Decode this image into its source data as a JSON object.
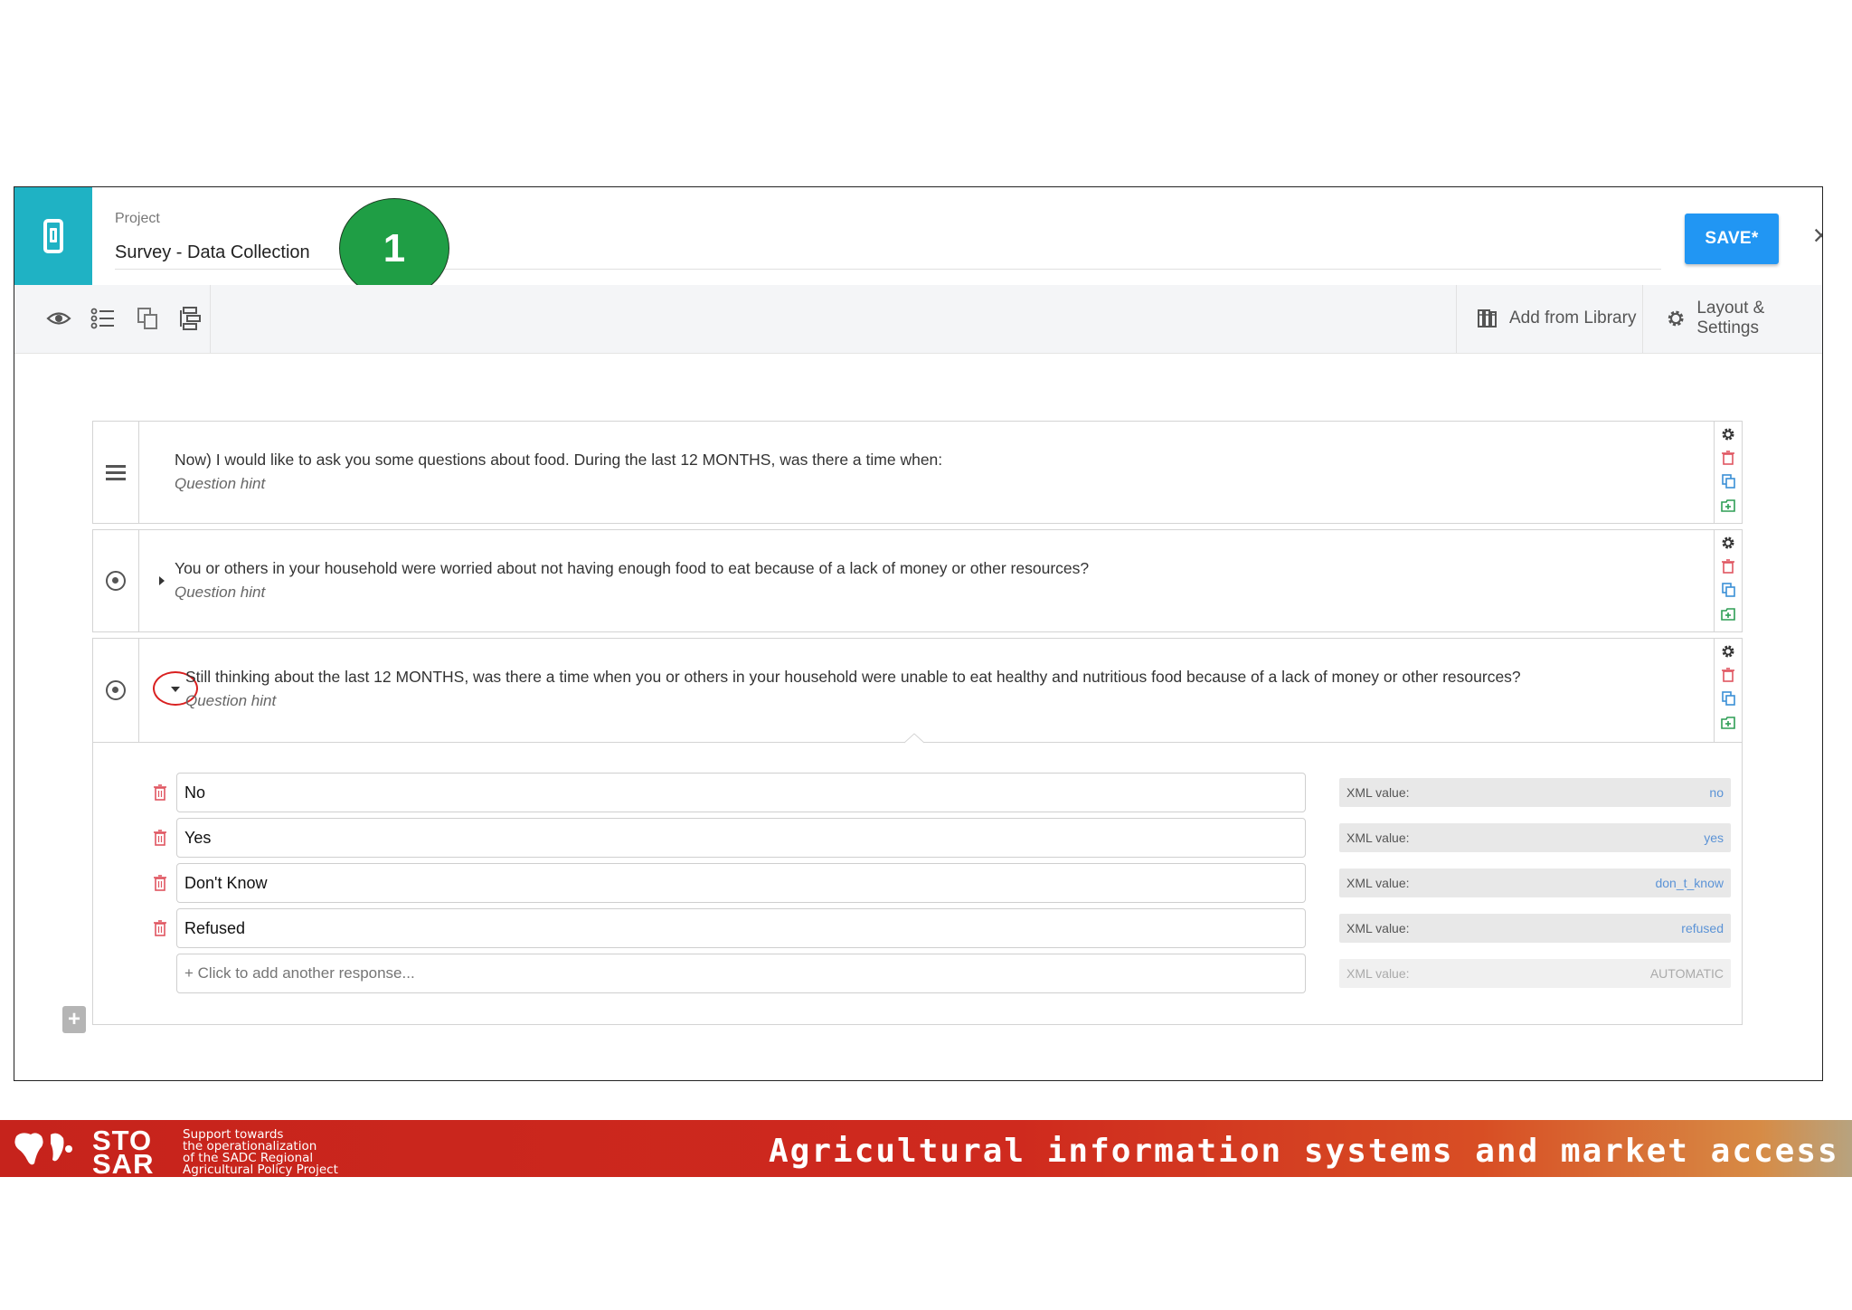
{
  "header": {
    "project_label": "Project",
    "project_title": "Survey - Data Collection",
    "step_badge": "1",
    "save_label": "SAVE*",
    "close_symbol": "×",
    "accent_color": "#1fb2c4",
    "save_color": "#2196f3"
  },
  "toolbar": {
    "icons": [
      "eye-icon",
      "question-list-icon",
      "copy-icon",
      "form-structure-icon"
    ],
    "add_from_library": "Add from Library",
    "layout_settings": "Layout & Settings"
  },
  "questions": [
    {
      "type_icon": "hamburger-icon",
      "label": "Now) I would like to ask you some questions about food. During the last 12 MONTHS, was there a time when:",
      "hint": "Question hint"
    },
    {
      "type_icon": "radio-icon",
      "label": "You or others in your household were worried about not having enough food to eat because of a lack of money or other resources?",
      "hint": "Question hint"
    },
    {
      "type_icon": "radio-icon",
      "label": "Still thinking about the last 12 MONTHS, was there a time when you or others in your household were unable to eat healthy and nutritious food because of a lack of money or other resources?",
      "hint": "Question hint",
      "expanded": true
    }
  ],
  "responses": [
    {
      "label": "No",
      "xml_label": "XML value:",
      "xml_value": "no"
    },
    {
      "label": "Yes",
      "xml_label": "XML value:",
      "xml_value": "yes"
    },
    {
      "label": "Don't Know",
      "xml_label": "XML value:",
      "xml_value": "don_t_know"
    },
    {
      "label": "Refused",
      "xml_label": "XML value:",
      "xml_value": "refused"
    }
  ],
  "add_response": {
    "placeholder": "+ Click to add another response...",
    "xml_label": "XML value:",
    "xml_value": "AUTOMATIC"
  },
  "banner": {
    "logo_line1": "STO",
    "logo_line2": "SAR",
    "sub_lines": [
      "Support towards",
      "the operationalization",
      "of the SADC Regional",
      "Agricultural Policy Project"
    ],
    "tagline": "Agricultural information systems and market access"
  }
}
